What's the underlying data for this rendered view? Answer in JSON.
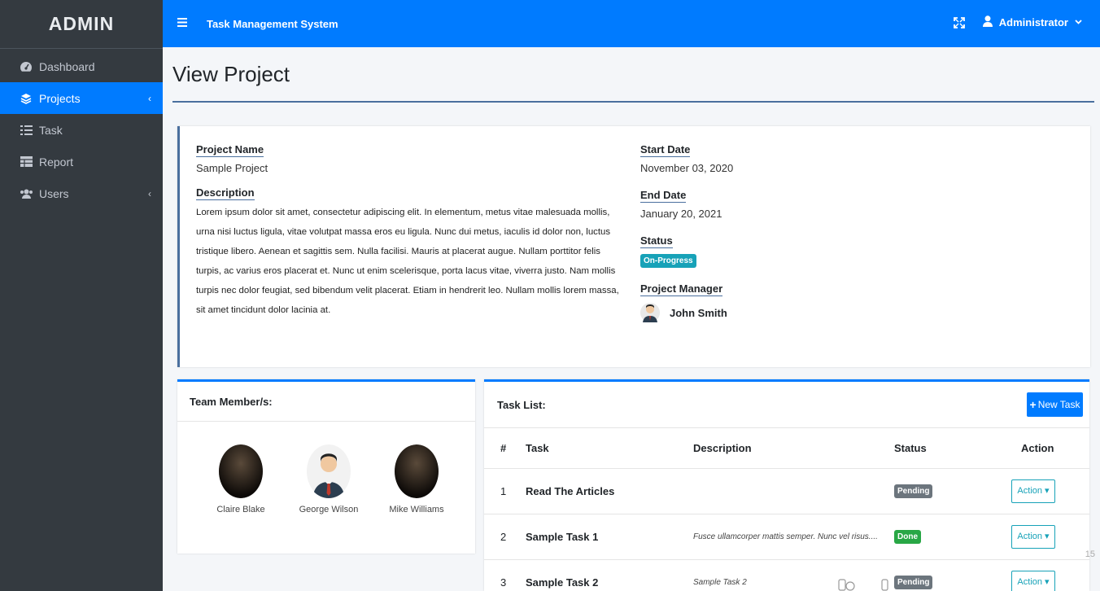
{
  "sidebar": {
    "brand": "ADMIN",
    "items": [
      {
        "label": "Dashboard",
        "icon": "tachometer-icon",
        "active": false
      },
      {
        "label": "Projects",
        "icon": "layers-icon",
        "active": true,
        "chevron": "‹"
      },
      {
        "label": "Task",
        "icon": "list-icon",
        "active": false
      },
      {
        "label": "Report",
        "icon": "table-icon",
        "active": false
      },
      {
        "label": "Users",
        "icon": "users-icon",
        "active": false,
        "chevron": "‹"
      }
    ]
  },
  "topbar": {
    "title": "Task Management System",
    "user": "Administrator"
  },
  "page": {
    "title": "View Project"
  },
  "project": {
    "name_label": "Project Name",
    "name": "Sample Project",
    "description_label": "Description",
    "description": "Lorem ipsum dolor sit amet, consectetur adipiscing elit. In elementum, metus vitae malesuada mollis, urna nisi luctus ligula, vitae volutpat massa eros eu ligula. Nunc dui metus, iaculis id dolor non, luctus tristique libero. Aenean et sagittis sem. Nulla facilisi. Mauris at placerat augue. Nullam porttitor felis turpis, ac varius eros placerat et. Nunc ut enim scelerisque, porta lacus vitae, viverra justo. Nam mollis turpis nec dolor feugiat, sed bibendum velit placerat. Etiam in hendrerit leo. Nullam mollis lorem massa, sit amet tincidunt dolor lacinia at.",
    "start_label": "Start Date",
    "start": "November 03, 2020",
    "end_label": "End Date",
    "end": "January 20, 2021",
    "status_label": "Status",
    "status": "On-Progress",
    "manager_label": "Project Manager",
    "manager": "John Smith"
  },
  "team": {
    "title": "Team Member/s:",
    "members": [
      "Claire Blake",
      "George Wilson",
      "Mike Williams"
    ]
  },
  "tasks": {
    "title": "Task List:",
    "new_button": "New Task",
    "headers": [
      "#",
      "Task",
      "Description",
      "Status",
      "Action"
    ],
    "rows": [
      {
        "num": "1",
        "task": "Read The Articles",
        "desc": "",
        "status": "Pending",
        "action": "Action"
      },
      {
        "num": "2",
        "task": "Sample Task 1",
        "desc": "Fusce ullamcorper mattis semper. Nunc vel risus....",
        "status": "Done",
        "action": "Action"
      },
      {
        "num": "3",
        "task": "Sample Task 2",
        "desc": "Sample Task 2",
        "status": "Pending",
        "action": "Action"
      }
    ]
  },
  "page_number": "15",
  "colors": {
    "primary": "#007bff",
    "sidebar": "#343a40",
    "info": "#17a2b8",
    "success": "#28a745",
    "secondary": "#6c757d"
  }
}
